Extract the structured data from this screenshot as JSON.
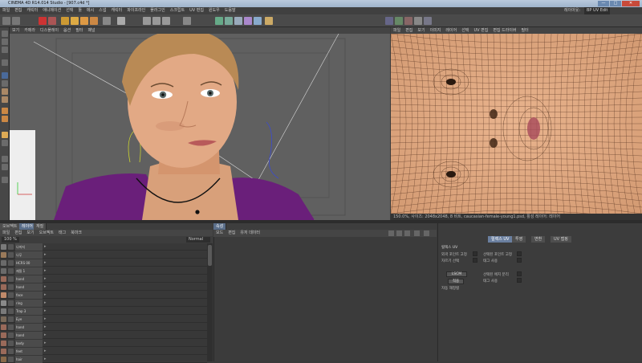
{
  "app": {
    "title": "CINEMA 4D R14.014 Studio - [907.c4d *]"
  },
  "menubar": {
    "items": [
      "파일",
      "편집",
      "캐릭터",
      "애니메이션",
      "선택",
      "툴",
      "메시",
      "스냅",
      "캐릭터",
      "파이프라인",
      "플러그인",
      "스크립트",
      "UV 편집",
      "윈도우",
      "도움말"
    ],
    "layout_label": "레이아웃:",
    "layout_value": "BP UV Edit"
  },
  "viewport": {
    "menu": [
      "보기",
      "카메라",
      "디스플레이",
      "옵션",
      "필터",
      "패널"
    ]
  },
  "uvview": {
    "menu": [
      "파일",
      "편집",
      "보기",
      "이미지",
      "레이어",
      "선택",
      "UV 편집",
      "편집 드라이버",
      "필터"
    ],
    "status": "150.0%, 사이즈: 2048x2048, 8 비트, caucasian-female-young1.psd, 활성 레이어: 레이어"
  },
  "object_manager": {
    "tabs": [
      "오브젝트",
      "레이어",
      "재질"
    ],
    "menu": [
      "파일",
      "편집",
      "보기",
      "오브젝트",
      "태그",
      "북마크"
    ],
    "zoom": "100 %",
    "mode": "Normal",
    "rows": [
      {
        "name": "나머지",
        "color": "#7a7a7a"
      },
      {
        "name": "나무",
        "color": "#9a7a5a"
      },
      {
        "name": "HCRS 00",
        "color": "#6a6a6a"
      },
      {
        "name": "재질 1",
        "color": "#6a6a6a"
      },
      {
        "name": "hand",
        "color": "#9a6a5a"
      },
      {
        "name": "hand",
        "color": "#9a6a5a"
      },
      {
        "name": "face",
        "color": "#c08a6a"
      },
      {
        "name": "ring",
        "color": "#8a8a8a"
      },
      {
        "name": "Trap 3",
        "color": "#7a7a7a"
      },
      {
        "name": "Eye",
        "color": "#7a6a5a"
      },
      {
        "name": "hand",
        "color": "#9a6a5a"
      },
      {
        "name": "hand",
        "color": "#9a6a5a"
      },
      {
        "name": "body",
        "color": "#9a6a5a"
      },
      {
        "name": "feet",
        "color": "#9a6a5a"
      },
      {
        "name": "hair",
        "color": "#8a6a4a"
      }
    ]
  },
  "mid_panel": {
    "tabs": [
      "속성"
    ],
    "menu": [
      "모드",
      "편집",
      "유저 데이터"
    ]
  },
  "attributes": {
    "tabs": [
      "릴렉스 UV",
      "투영",
      "변환",
      "UV 맵핑"
    ],
    "selected_tab_index": 0,
    "section_title": "릴렉스 UV",
    "rows": [
      {
        "label": "외곽 포인트 고정",
        "label2": "선택된 포인트 고정"
      },
      {
        "label": "자르기 선택",
        "label2": "태그 사용"
      }
    ],
    "method_value": "LSCM",
    "apply_label": "적용",
    "auto_label": "자동 재정렬",
    "extra": [
      {
        "label2": "선택된 에지 분리"
      },
      {
        "label2": "태그 사용"
      }
    ]
  },
  "colors": {
    "accent": "#5a6e8a",
    "uv_skin": "#d9a47e"
  }
}
